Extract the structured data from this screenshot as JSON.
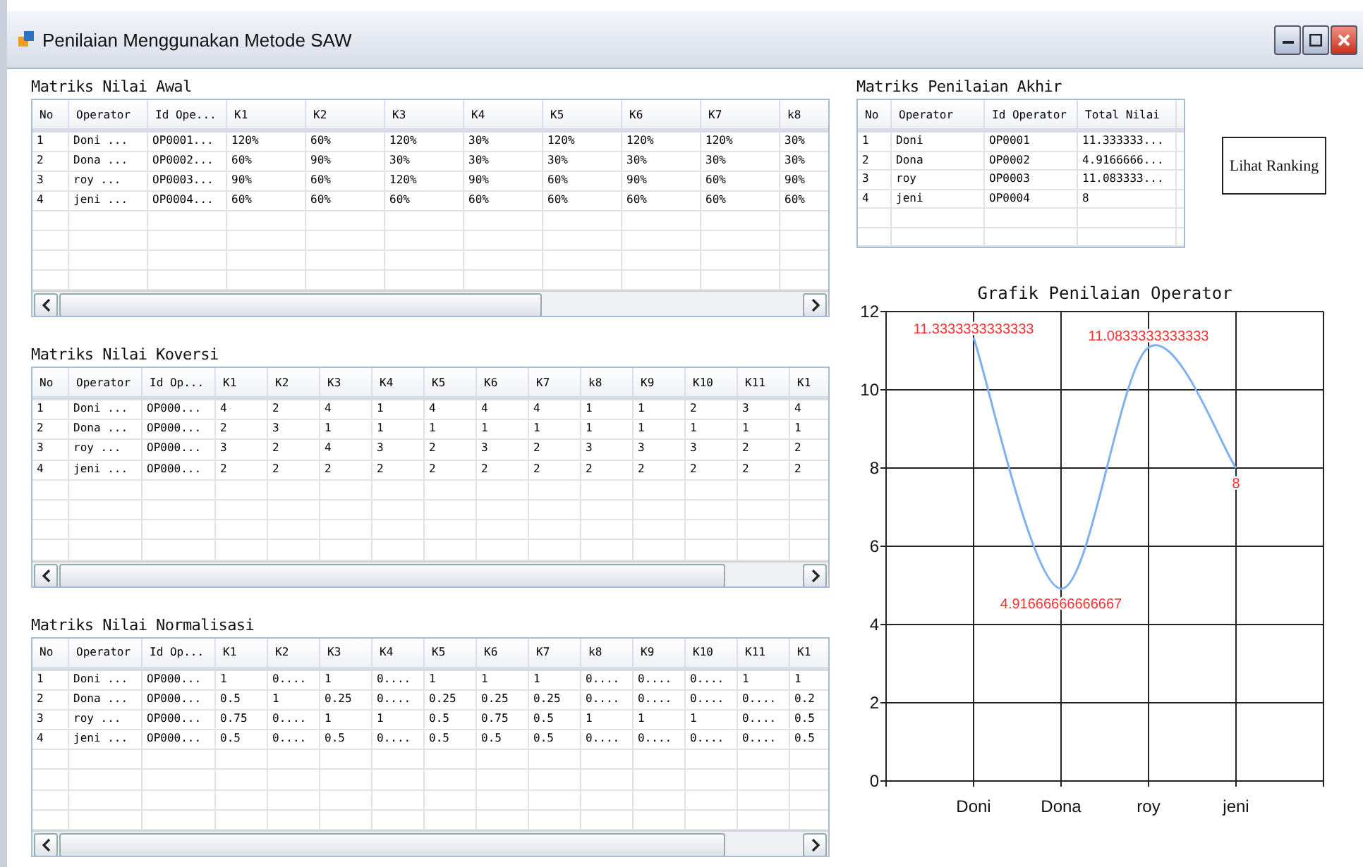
{
  "window": {
    "title": "Penilaian Menggunakan Metode SAW"
  },
  "tables": [
    {
      "title": "Matriks Nilai Awal",
      "columns": [
        "No",
        "Operator",
        "Id Ope...",
        "K1",
        "K2",
        "K3",
        "K4",
        "K5",
        "K6",
        "K7",
        "k8"
      ],
      "rows": [
        [
          "1",
          "Doni  ...",
          "OP0001...",
          "120%",
          "60%",
          "120%",
          "30%",
          "120%",
          "120%",
          "120%",
          "30%"
        ],
        [
          "2",
          "Dona  ...",
          "OP0002...",
          "60%",
          "90%",
          "30%",
          "30%",
          "30%",
          "30%",
          "30%",
          "30%"
        ],
        [
          "3",
          "roy   ...",
          "OP0003...",
          "90%",
          "60%",
          "120%",
          "90%",
          "60%",
          "90%",
          "60%",
          "90%"
        ],
        [
          "4",
          "jeni  ...",
          "OP0004...",
          "60%",
          "60%",
          "60%",
          "60%",
          "60%",
          "60%",
          "60%",
          "60%"
        ]
      ]
    },
    {
      "title": "Matriks Nilai Koversi",
      "columns": [
        "No",
        "Operator",
        "Id Op...",
        "K1",
        "K2",
        "K3",
        "K4",
        "K5",
        "K6",
        "K7",
        "k8",
        "K9",
        "K10",
        "K11",
        "K1"
      ],
      "rows": [
        [
          "1",
          "Doni ...",
          "OP000...",
          "4",
          "2",
          "4",
          "1",
          "4",
          "4",
          "4",
          "1",
          "1",
          "2",
          "3",
          "4"
        ],
        [
          "2",
          "Dona ...",
          "OP000...",
          "2",
          "3",
          "1",
          "1",
          "1",
          "1",
          "1",
          "1",
          "1",
          "1",
          "1",
          "1"
        ],
        [
          "3",
          "roy  ...",
          "OP000...",
          "3",
          "2",
          "4",
          "3",
          "2",
          "3",
          "2",
          "3",
          "3",
          "3",
          "2",
          "2"
        ],
        [
          "4",
          "jeni ...",
          "OP000...",
          "2",
          "2",
          "2",
          "2",
          "2",
          "2",
          "2",
          "2",
          "2",
          "2",
          "2",
          "2"
        ]
      ]
    },
    {
      "title": "Matriks Nilai Normalisasi",
      "columns": [
        "No",
        "Operator",
        "Id Op...",
        "K1",
        "K2",
        "K3",
        "K4",
        "K5",
        "K6",
        "K7",
        "k8",
        "K9",
        "K10",
        "K11",
        "K1"
      ],
      "rows": [
        [
          "1",
          "Doni ...",
          "OP000...",
          "1",
          "0....",
          "1",
          "0....",
          "1",
          "1",
          "1",
          "0....",
          "0....",
          "0....",
          "1",
          "1"
        ],
        [
          "2",
          "Dona ...",
          "OP000...",
          "0.5",
          "1",
          "0.25",
          "0....",
          "0.25",
          "0.25",
          "0.25",
          "0....",
          "0....",
          "0....",
          "0....",
          "0.2"
        ],
        [
          "3",
          "roy  ...",
          "OP000...",
          "0.75",
          "0....",
          "1",
          "1",
          "0.5",
          "0.75",
          "0.5",
          "1",
          "1",
          "1",
          "0....",
          "0.5"
        ],
        [
          "4",
          "jeni ...",
          "OP000...",
          "0.5",
          "0....",
          "0.5",
          "0....",
          "0.5",
          "0.5",
          "0.5",
          "0....",
          "0....",
          "0....",
          "0....",
          "0.5"
        ]
      ]
    }
  ],
  "final_table": {
    "title": "Matriks Penilaian Akhir",
    "columns": [
      "No",
      "Operator",
      "Id Operator",
      "Total Nilai"
    ],
    "rows": [
      [
        "1",
        "Doni",
        "OP0001",
        "11.333333..."
      ],
      [
        "2",
        "Dona",
        "OP0002",
        "4.9166666..."
      ],
      [
        "3",
        "roy",
        "OP0003",
        "11.083333..."
      ],
      [
        "4",
        "jeni",
        "OP0004",
        "8"
      ]
    ]
  },
  "ranking_button": {
    "label": "Lihat Ranking"
  },
  "chart": {
    "chart_data": {
      "type": "line",
      "title": "Grafik Penilaian Operator",
      "categories": [
        "Doni",
        "Dona",
        "roy",
        "jeni"
      ],
      "grid": true,
      "series": [
        {
          "color": "#7fb0f0",
          "values": [
            11.3333333333333,
            4.91666666666667,
            11.0833333333333,
            8
          ]
        }
      ],
      "ylim": [
        0,
        12
      ],
      "yticks": [
        0,
        2,
        4,
        6,
        8,
        10,
        12
      ],
      "data_labels": true,
      "value_labels": [
        "11.3333333333333",
        "4.91666666666667",
        "11.0833333333333",
        "8"
      ]
    }
  }
}
